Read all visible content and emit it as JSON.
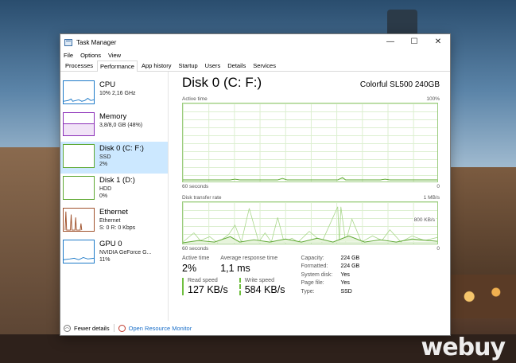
{
  "window": {
    "title": "Task Manager",
    "controls": {
      "minimize": "—",
      "maximize": "☐",
      "close": "✕"
    }
  },
  "menu": [
    "File",
    "Options",
    "View"
  ],
  "tabs": [
    {
      "label": "Processes",
      "active": false
    },
    {
      "label": "Performance",
      "active": true
    },
    {
      "label": "App history",
      "active": false
    },
    {
      "label": "Startup",
      "active": false
    },
    {
      "label": "Users",
      "active": false
    },
    {
      "label": "Details",
      "active": false
    },
    {
      "label": "Services",
      "active": false
    }
  ],
  "sidebar": [
    {
      "name": "CPU",
      "sub1": "10% 2,16 GHz",
      "sub2": "",
      "color": "#1e7ac8",
      "selected": false
    },
    {
      "name": "Memory",
      "sub1": "3,8/8,0 GB (48%)",
      "sub2": "",
      "color": "#8b2fb8",
      "selected": false
    },
    {
      "name": "Disk 0 (C: F:)",
      "sub1": "SSD",
      "sub2": "2%",
      "color": "#5ea832",
      "selected": true
    },
    {
      "name": "Disk 1 (D:)",
      "sub1": "HDD",
      "sub2": "0%",
      "color": "#5ea832",
      "selected": false
    },
    {
      "name": "Ethernet",
      "sub1": "Ethernet",
      "sub2": "S: 0 R: 0 Kbps",
      "color": "#a0522d",
      "selected": false
    },
    {
      "name": "GPU 0",
      "sub1": "NVIDIA GeForce G...",
      "sub2": "11%",
      "color": "#1e7ac8",
      "selected": false
    }
  ],
  "main": {
    "title": "Disk 0 (C: F:)",
    "model": "Colorful SL500 240GB",
    "active_chart": {
      "label": "Active time",
      "max": "100%",
      "foot_left": "60 seconds",
      "foot_right": "0"
    },
    "rate_chart": {
      "label": "Disk transfer rate",
      "max": "1 MB/s",
      "mid": "800 KB/s",
      "foot_left": "60 seconds",
      "foot_right": "0"
    },
    "stats": {
      "active_time_label": "Active time",
      "active_time_value": "2%",
      "response_label": "Average response time",
      "response_value": "1,1 ms",
      "read_label": "Read speed",
      "read_value": "127 KB/s",
      "write_label": "Write speed",
      "write_value": "584 KB/s"
    },
    "properties": [
      {
        "key": "Capacity:",
        "value": "224 GB"
      },
      {
        "key": "Formatted:",
        "value": "224 GB"
      },
      {
        "key": "System disk:",
        "value": "Yes"
      },
      {
        "key": "Page file:",
        "value": "Yes"
      },
      {
        "key": "Type:",
        "value": "SSD"
      }
    ]
  },
  "footer": {
    "fewer_details": "Fewer details",
    "open_monitor": "Open Resource Monitor"
  },
  "watermark": "webuy",
  "colors": {
    "disk_green": "#5ea832",
    "selection": "#cce8ff"
  }
}
